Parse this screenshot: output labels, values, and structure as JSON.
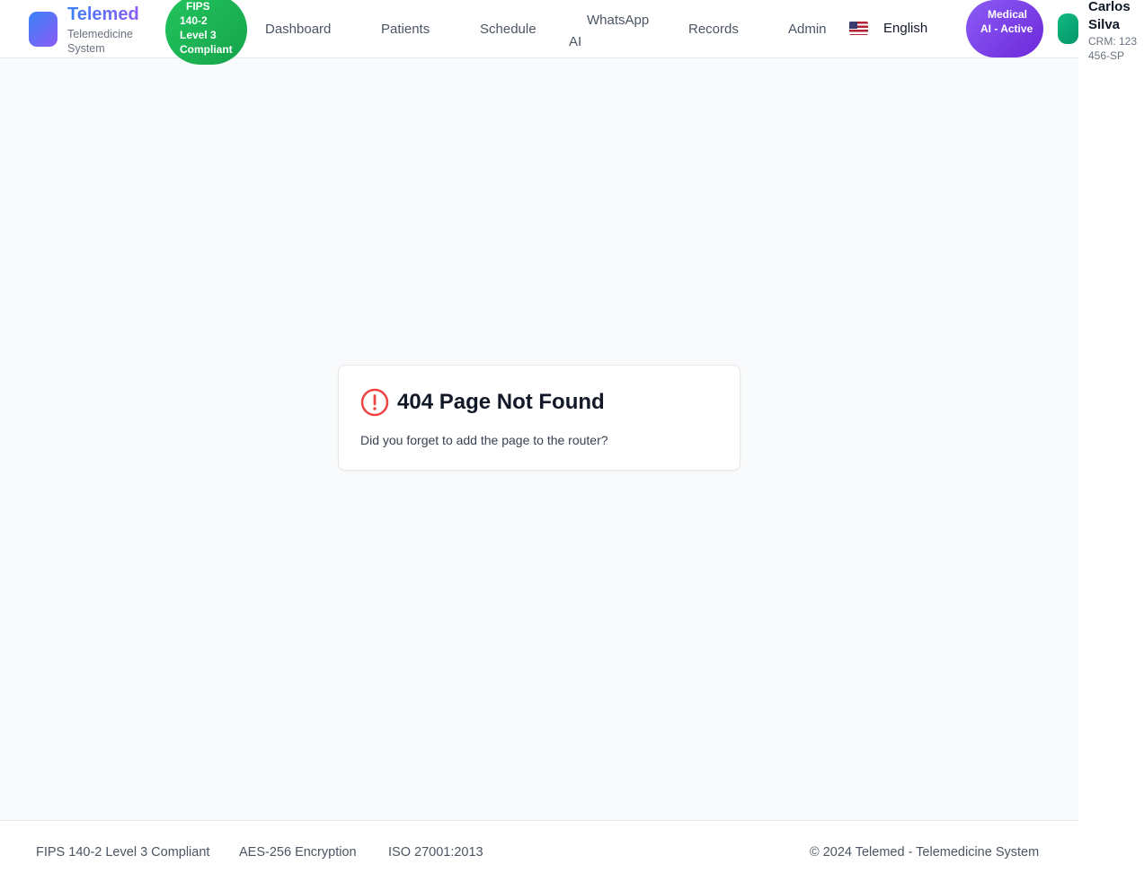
{
  "header": {
    "brand": {
      "title": "Telemed",
      "subtitle": "Telemedicine System"
    },
    "fips_badge": {
      "line1": "FIPS",
      "line2": "140-2 Level 3 Compliant"
    },
    "nav": {
      "dashboard": "Dashboard",
      "patients": "Patients",
      "schedule": "Schedule",
      "whatsapp_line1": "WhatsApp",
      "whatsapp_line2": "AI",
      "records": "Records",
      "admin": "Admin"
    },
    "language": {
      "label": "English",
      "flag_icon": "us-flag-icon"
    },
    "ai_badge": {
      "line1": "Medical",
      "line2": "AI - Active"
    },
    "user": {
      "name": "Carlos Silva",
      "crm": "CRM: 123456-SP"
    }
  },
  "error_card": {
    "icon": "alert-circle-icon",
    "title": "404 Page Not Found",
    "message": "Did you forget to add the page to the router?"
  },
  "footer": {
    "fips": "FIPS 140-2 Level 3 Compliant",
    "aes": "AES-256 Encryption",
    "iso": "ISO 27001:2013",
    "copyright": "© 2024 Telemed - Telemedicine System"
  },
  "colors": {
    "brand_gradient_start": "#3b82f6",
    "brand_gradient_end": "#8b5cf6",
    "fips_green": "#22c55e",
    "ai_purple": "#7c3aed",
    "error_red": "#ef4444",
    "background": "#f9fafb"
  }
}
